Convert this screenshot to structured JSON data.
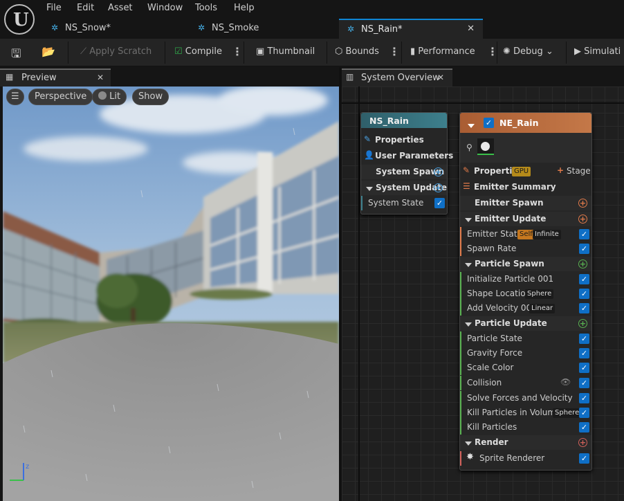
{
  "menu": {
    "items": [
      "File",
      "Edit",
      "Asset",
      "Window",
      "Tools",
      "Help"
    ]
  },
  "tabs": [
    {
      "label": "NS_Snow*"
    },
    {
      "label": "NS_Smoke"
    },
    {
      "label": "NS_Rain*"
    }
  ],
  "toolbar": {
    "apply_scratch": "Apply Scratch",
    "compile": "Compile",
    "thumbnail": "Thumbnail",
    "bounds": "Bounds",
    "performance": "Performance",
    "debug": "Debug",
    "simulation": "Simulati"
  },
  "preview": {
    "tab_label": "Preview",
    "perspective": "Perspective",
    "lit": "Lit",
    "show": "Show"
  },
  "overview": {
    "tab_label": "System Overview"
  },
  "system_node": {
    "title": "NS_Rain",
    "properties": "Properties",
    "user_parameters": "User Parameters",
    "system_spawn": "System Spawn",
    "system_update": "System Update",
    "system_state": "System State"
  },
  "emitter_node": {
    "title": "NE_Rain",
    "properties": "Properties",
    "gpu_badge": "GPU",
    "stage": "Stage",
    "summary": "Emitter Summary",
    "emitter_spawn": "Emitter Spawn",
    "emitter_update": "Emitter Update",
    "emitter_state": "Emitter State",
    "self_badge": "Self",
    "infinite_badge": "Infinite",
    "spawn_rate": "Spawn Rate",
    "particle_spawn": "Particle Spawn",
    "initialize_particle": "Initialize Particle 001",
    "shape_location": "Shape Location",
    "sphere_badge": "Sphere",
    "add_velocity": "Add Velocity 001",
    "linear_badge": "Linear",
    "particle_update": "Particle Update",
    "particle_state": "Particle State",
    "gravity_force": "Gravity Force",
    "scale_color": "Scale Color",
    "collision": "Collision",
    "solve_forces": "Solve Forces and Velocity",
    "kill_in_volume": "Kill Particles in Volume",
    "sphere_badge2": "Sphere",
    "kill_particles": "Kill Particles",
    "render": "Render",
    "sprite_renderer": "Sprite Renderer"
  },
  "colors": {
    "accent_blue": "#0e86d4",
    "emitter_header": "#b8683a",
    "system_header": "#3d7f8c",
    "spawn_green": "#58b050",
    "update_orange": "#e07a4a",
    "render_red": "#d0605a"
  }
}
